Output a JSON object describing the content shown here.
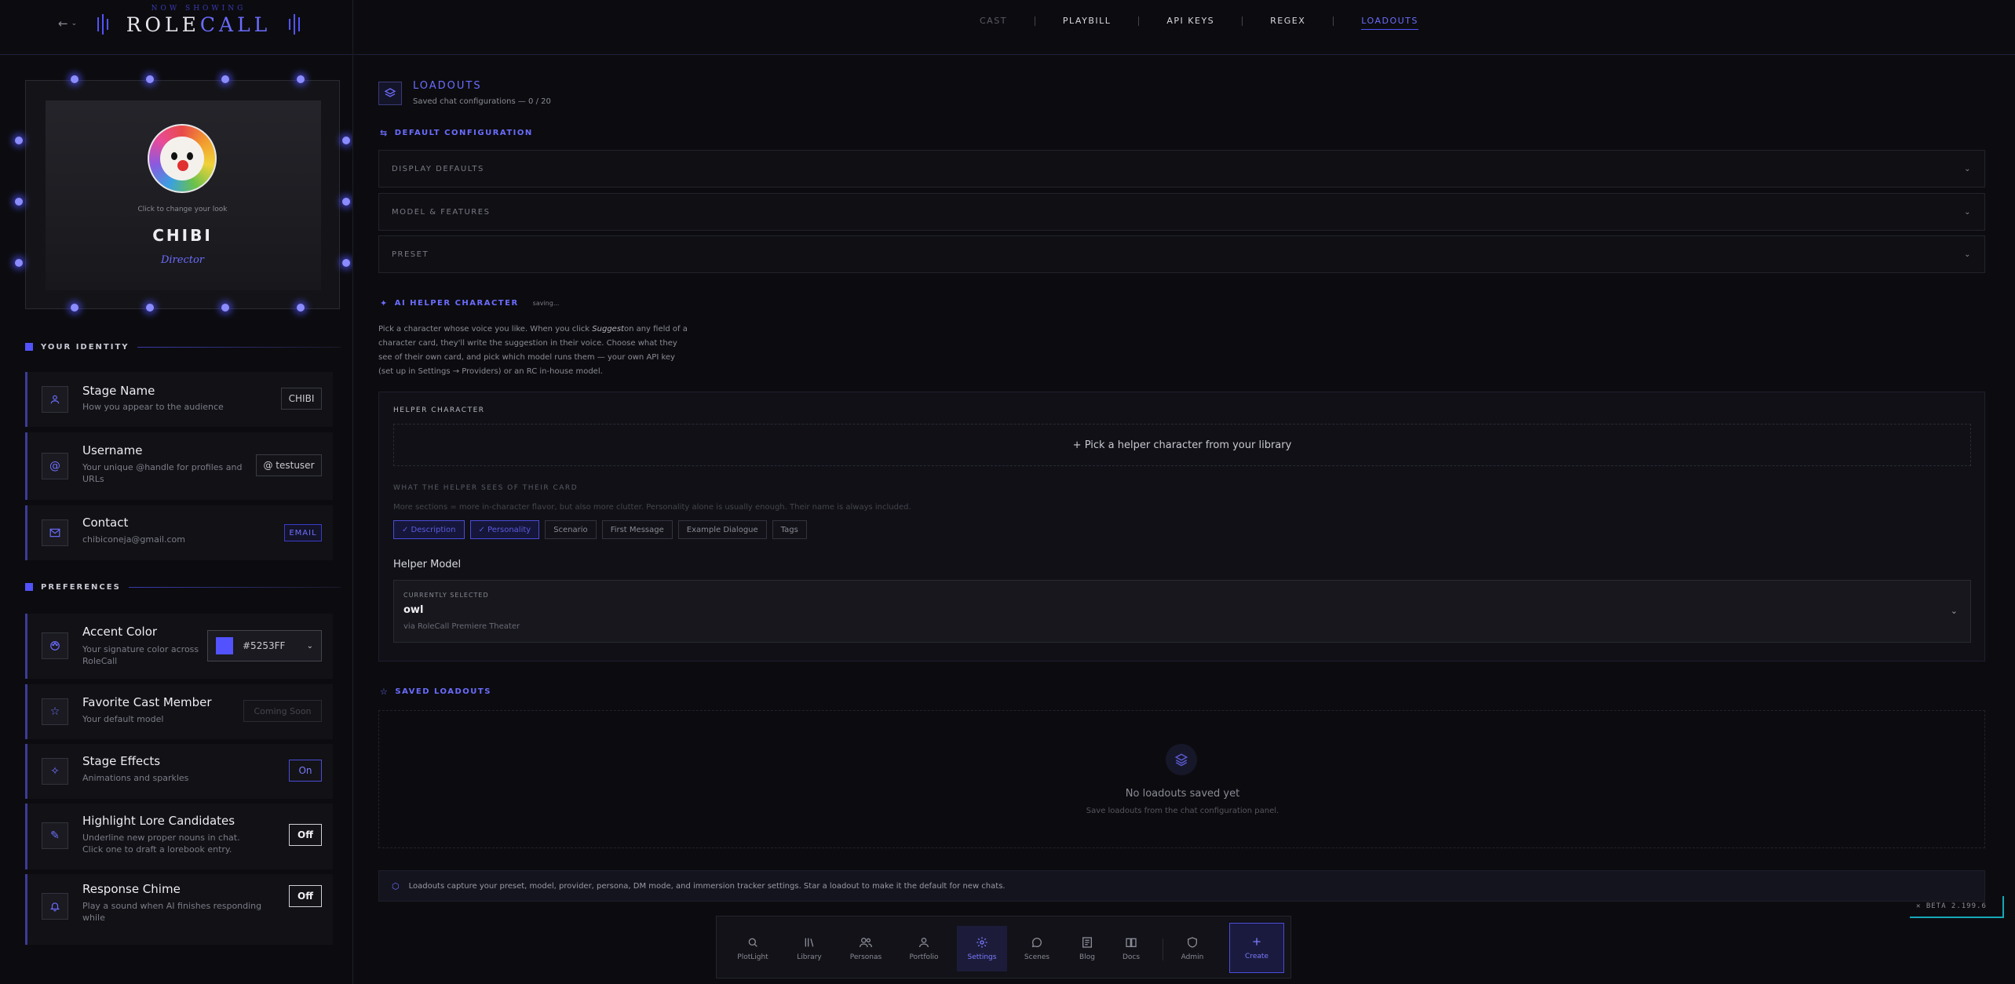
{
  "brand": {
    "tagline": "NOW SHOWING",
    "name_a": "ROLE",
    "name_b": "CALL"
  },
  "nav": [
    {
      "label": "CAST",
      "state": "dim"
    },
    {
      "label": "PLAYBILL",
      "state": "normal"
    },
    {
      "label": "API KEYS",
      "state": "normal"
    },
    {
      "label": "REGEX",
      "state": "normal"
    },
    {
      "label": "LOADOUTS",
      "state": "active"
    }
  ],
  "profile": {
    "hint": "Click to change your look",
    "name": "CHIBI",
    "role": "Director"
  },
  "identity": {
    "heading": "YOUR IDENTITY",
    "stage_name": {
      "title": "Stage Name",
      "desc": "How you appear to the audience",
      "value": "CHIBI"
    },
    "username": {
      "title": "Username",
      "desc": "Your unique @handle for profiles and URLs",
      "value": "@ testuser"
    },
    "contact": {
      "title": "Contact",
      "desc": "chibiconeja@gmail.com",
      "value": "EMAIL"
    }
  },
  "preferences": {
    "heading": "PREFERENCES",
    "accent": {
      "title": "Accent Color",
      "desc": "Your signature color across RoleCall",
      "value": "#5253FF"
    },
    "favorite": {
      "title": "Favorite Cast Member",
      "desc": "Your default model",
      "value": "Coming Soon"
    },
    "effects": {
      "title": "Stage Effects",
      "desc": "Animations and sparkles",
      "value": "On"
    },
    "lore": {
      "title": "Highlight Lore Candidates",
      "desc": "Underline new proper nouns in chat. Click one to draft a lorebook entry.",
      "value": "Off"
    },
    "chime": {
      "title": "Response Chime",
      "desc": "Play a sound when AI finishes responding while",
      "value": "Off"
    }
  },
  "loadouts": {
    "title": "LOADOUTS",
    "subtitle": "Saved chat configurations — 0 / 20",
    "default_heading": "DEFAULT CONFIGURATION",
    "accordions": [
      "DISPLAY DEFAULTS",
      "MODEL & FEATURES",
      "PRESET"
    ]
  },
  "helper": {
    "heading": "AI HELPER CHARACTER",
    "status": "saving...",
    "desc_a": "Pick a character whose voice you like. When you click ",
    "desc_em": "Suggest",
    "desc_b": "on any field of a character card, they'll write the suggestion in their voice. Choose what they see of their own card, and pick which model runs them — your own API key (set up in Settings → Providers) or an RC in-house model.",
    "panel_label": "HELPER CHARACTER",
    "pick_label": "+ Pick a helper character from your library",
    "sees_label": "WHAT THE HELPER SEES OF THEIR CARD",
    "sees_note": "More sections = more in-character flavor, but also more clutter. Personality alone is usually enough. Their name is always included.",
    "chips": [
      {
        "label": "✓ Description",
        "selected": true
      },
      {
        "label": "✓ Personality",
        "selected": true
      },
      {
        "label": "Scenario",
        "selected": false
      },
      {
        "label": "First Message",
        "selected": false
      },
      {
        "label": "Example Dialogue",
        "selected": false
      },
      {
        "label": "Tags",
        "selected": false
      }
    ],
    "model_title": "Helper Model",
    "model_current_label": "CURRENTLY SELECTED",
    "model_name": "owl",
    "model_via": "via RoleCall Premiere Theater"
  },
  "saved": {
    "heading": "SAVED LOADOUTS",
    "empty_title": "No loadouts saved yet",
    "empty_sub": "Save loadouts from the chat configuration panel."
  },
  "info": "Loadouts capture your preset, model, provider, persona, DM mode, and immersion tracker settings. Star a loadout to make it the default for new chats.",
  "dock": [
    {
      "label": "PlotLight",
      "icon": "search-icon"
    },
    {
      "label": "Library",
      "icon": "library-icon"
    },
    {
      "label": "Personas",
      "icon": "users-icon"
    },
    {
      "label": "Portfolio",
      "icon": "user-icon"
    },
    {
      "label": "Settings",
      "icon": "gear-icon",
      "active": true
    },
    {
      "label": "Scenes",
      "icon": "chat-bubble-icon"
    },
    {
      "label": "Blog",
      "icon": "blog-icon"
    },
    {
      "label": "Docs",
      "icon": "docs-icon"
    },
    {
      "label": "Admin",
      "icon": "shield-icon"
    },
    {
      "label": "Create",
      "icon": "plus-icon"
    }
  ],
  "beta": "✕ BETA 2.199.6",
  "colors": {
    "accent": "#5253FF",
    "beta_border": "#16a8b8"
  }
}
